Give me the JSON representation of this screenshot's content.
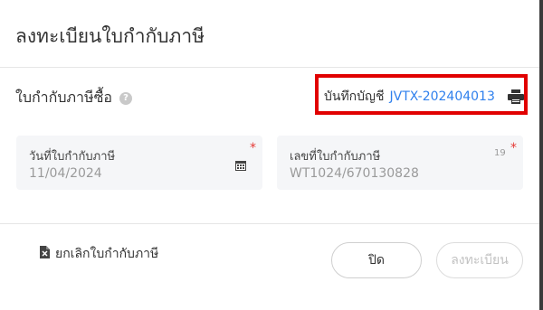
{
  "dialog": {
    "title": "ลงทะเบียนใบกำกับภาษี"
  },
  "section": {
    "title": "ใบกำกับภาษีซื้อ",
    "help_icon": "?"
  },
  "record": {
    "label": "บันทึกบัญชี",
    "number": "JVTX-202404013",
    "icon": "printer-icon"
  },
  "fields": {
    "date": {
      "label": "วันที่ใบกำกับภาษี",
      "value": "11/04/2024",
      "required": "*",
      "icon": "calendar-icon"
    },
    "invoice_no": {
      "label": "เลขที่ใบกำกับภาษี",
      "value": "WT1024/670130828",
      "required": "*",
      "count": "19"
    }
  },
  "footer": {
    "cancel_invoice_label": "ยกเลิกใบกำกับภาษี",
    "close_label": "ปิด",
    "register_label": "ลงทะเบียน"
  },
  "colors": {
    "accent": "#2f80ed",
    "highlight_border": "#e10000",
    "required": "#e53935"
  }
}
